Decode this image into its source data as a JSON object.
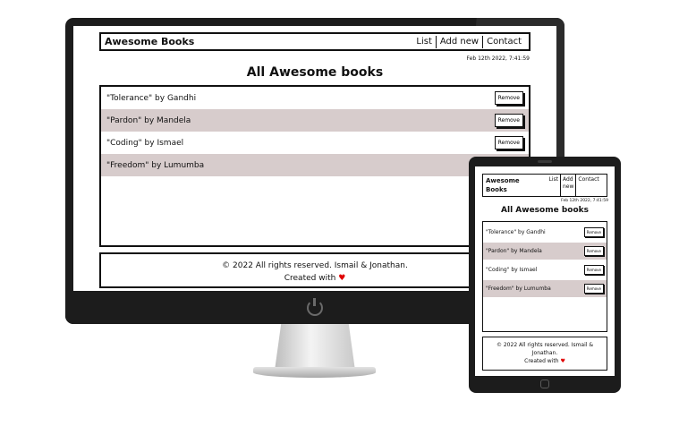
{
  "app": {
    "brand": "Awesome Books",
    "tablet_brand_line1": "Awesome",
    "tablet_brand_line2": "Books",
    "nav": {
      "list": "List",
      "add_new": "Add new",
      "add_line1": "Add",
      "add_line2": "new",
      "contact": "Contact"
    },
    "datetime": "Feb 12th 2022, 7:41:59",
    "title": "All Awesome books",
    "remove_label": "Remove",
    "books": [
      {
        "text": "\"Tolerance\" by Gandhi"
      },
      {
        "text": "\"Pardon\" by Mandela"
      },
      {
        "text": "\"Coding\" by Ismael"
      },
      {
        "text": "\"Freedom\" by Lumumba"
      }
    ],
    "footer": {
      "copyright": "© 2022 All rights reserved. Ismail & Jonathan.",
      "tablet_line1": "© 2022 All rights reserved. Ismail &",
      "tablet_line2": "Jonathan.",
      "created_with": "Created with",
      "heart": "♥"
    }
  },
  "colors": {
    "row_shade": "#d7cccc",
    "device_body": "#1c1c1c",
    "heart": "#e00000"
  }
}
